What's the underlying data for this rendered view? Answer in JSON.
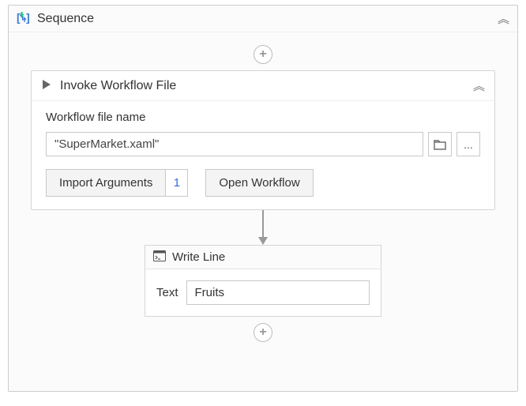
{
  "sequence": {
    "title": "Sequence"
  },
  "invoke": {
    "title": "Invoke Workflow File",
    "file_label": "Workflow file name",
    "file_value": "\"SuperMarket.xaml\"",
    "import_btn": "Import Arguments",
    "arg_count": "1",
    "open_btn": "Open Workflow"
  },
  "writeline": {
    "title": "Write Line",
    "text_label": "Text",
    "text_value": "Fruits"
  }
}
